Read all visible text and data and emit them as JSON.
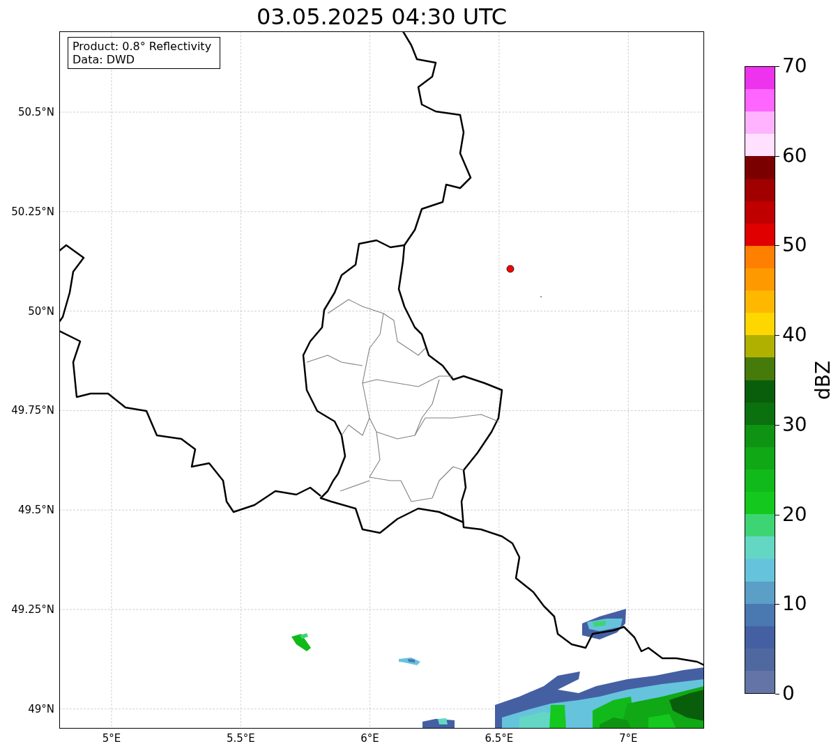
{
  "title": "03.05.2025 04:30 UTC",
  "info_box": {
    "lines": [
      "Product: 0.8° Reflectivity",
      "Data: DWD"
    ]
  },
  "map": {
    "lat_ticks": [
      "50.5°N",
      "50.25°N",
      "50°N",
      "49.75°N",
      "49.5°N",
      "49.25°N",
      "49°N"
    ],
    "lon_ticks": [
      "5°E",
      "5.5°E",
      "6°E",
      "6.5°E",
      "7°E"
    ],
    "marker": {
      "color": "#ff0000"
    }
  },
  "colorbar": {
    "label": "dBZ",
    "ticks": [
      "70",
      "60",
      "50",
      "40",
      "30",
      "20",
      "10",
      "0"
    ],
    "segments": [
      {
        "color": "#ee33ee"
      },
      {
        "color": "#ff66ff"
      },
      {
        "color": "#ffb3ff"
      },
      {
        "color": "#ffe0ff"
      },
      {
        "color": "#7a0000"
      },
      {
        "color": "#a00000"
      },
      {
        "color": "#c00000"
      },
      {
        "color": "#e00000"
      },
      {
        "color": "#ff7f00"
      },
      {
        "color": "#ff9900"
      },
      {
        "color": "#ffb800"
      },
      {
        "color": "#ffd700"
      },
      {
        "color": "#b0b000"
      },
      {
        "color": "#467a0a"
      },
      {
        "color": "#095e0b"
      },
      {
        "color": "#0b700e"
      },
      {
        "color": "#0e9412"
      },
      {
        "color": "#10a815"
      },
      {
        "color": "#12b91a"
      },
      {
        "color": "#14c81e"
      },
      {
        "color": "#3dd574"
      },
      {
        "color": "#64d7c4"
      },
      {
        "color": "#66c3dc"
      },
      {
        "color": "#5b9ec6"
      },
      {
        "color": "#4a78b0"
      },
      {
        "color": "#4560a2"
      },
      {
        "color": "#5068a0"
      },
      {
        "color": "#6474a6"
      }
    ]
  }
}
